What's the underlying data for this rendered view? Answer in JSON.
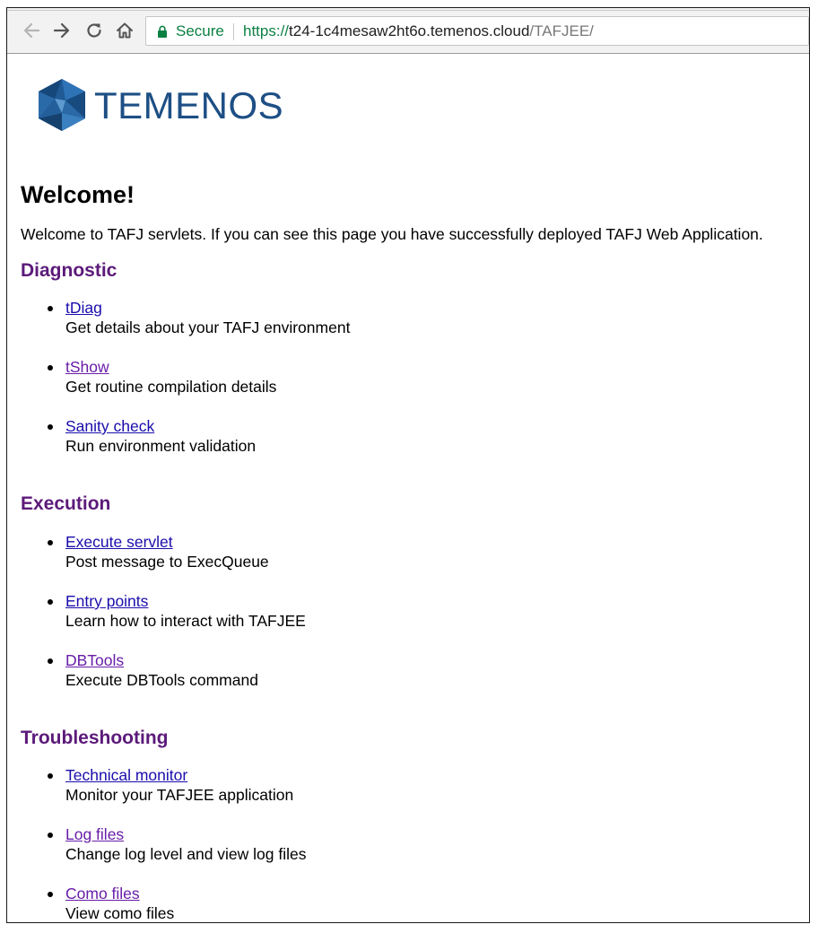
{
  "browser": {
    "secure_label": "Secure",
    "url_scheme": "https://",
    "url_host": "t24-1c4mesaw2ht6o.temenos.cloud",
    "url_path": "/TAFJEE/"
  },
  "logo": {
    "text": "TEMENOS"
  },
  "page": {
    "heading": "Welcome!",
    "intro": "Welcome to TAFJ servlets. If you can see this page you have successfully deployed TAFJ Web Application."
  },
  "sections": [
    {
      "title": "Diagnostic",
      "items": [
        {
          "link": "tDiag",
          "desc": "Get details about your TAFJ environment"
        },
        {
          "link": "tShow",
          "desc": "Get routine compilation details"
        },
        {
          "link": "Sanity check",
          "desc": "Run environment validation"
        }
      ]
    },
    {
      "title": "Execution",
      "items": [
        {
          "link": "Execute servlet",
          "desc": "Post message to ExecQueue"
        },
        {
          "link": "Entry points",
          "desc": "Learn how to interact with TAFJEE"
        },
        {
          "link": "DBTools",
          "desc": "Execute DBTools command"
        }
      ]
    },
    {
      "title": "Troubleshooting",
      "items": [
        {
          "link": "Technical monitor",
          "desc": "Monitor your TAFJEE application"
        },
        {
          "link": "Log files",
          "desc": "Change log level and view log files"
        },
        {
          "link": "Como files",
          "desc": "View como files"
        }
      ]
    }
  ],
  "colors": {
    "heading_purple": "#5c1a7a",
    "link_blue": "#1a0dab",
    "link_visited": "#681da8",
    "secure_green": "#0b8043",
    "logo_blue": "#1d4f85"
  }
}
